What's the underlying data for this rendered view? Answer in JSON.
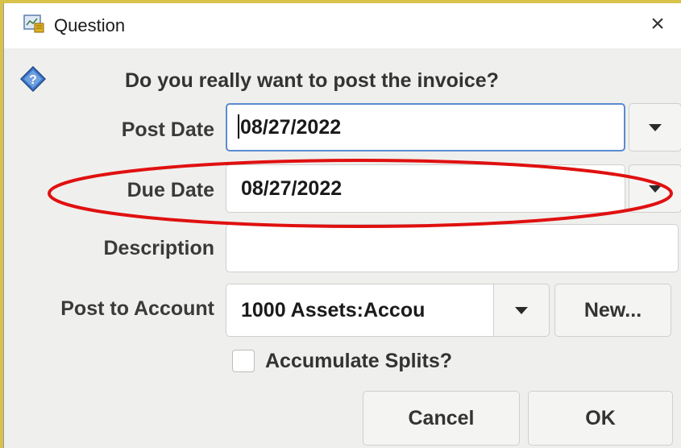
{
  "window": {
    "title": "Question",
    "close_glyph": "×",
    "app_icon": "gnucash-app-icon"
  },
  "message": {
    "icon": "question-diamond-icon",
    "text": "Do you really want to post the invoice?"
  },
  "form": {
    "post_date": {
      "label": "Post Date",
      "value": "08/27/2022"
    },
    "due_date": {
      "label": "Due Date",
      "value": "08/27/2022"
    },
    "description": {
      "label": "Description",
      "value": ""
    },
    "post_to_account": {
      "label": "Post to Account",
      "value": "1000 Assets:Accou",
      "new_button": "New..."
    },
    "accumulate_splits": {
      "label": "Accumulate Splits?",
      "checked": false
    }
  },
  "buttons": {
    "cancel": "Cancel",
    "ok": "OK"
  },
  "annotation": {
    "shape": "ellipse",
    "color": "#e01010",
    "target": "due-date-row"
  }
}
